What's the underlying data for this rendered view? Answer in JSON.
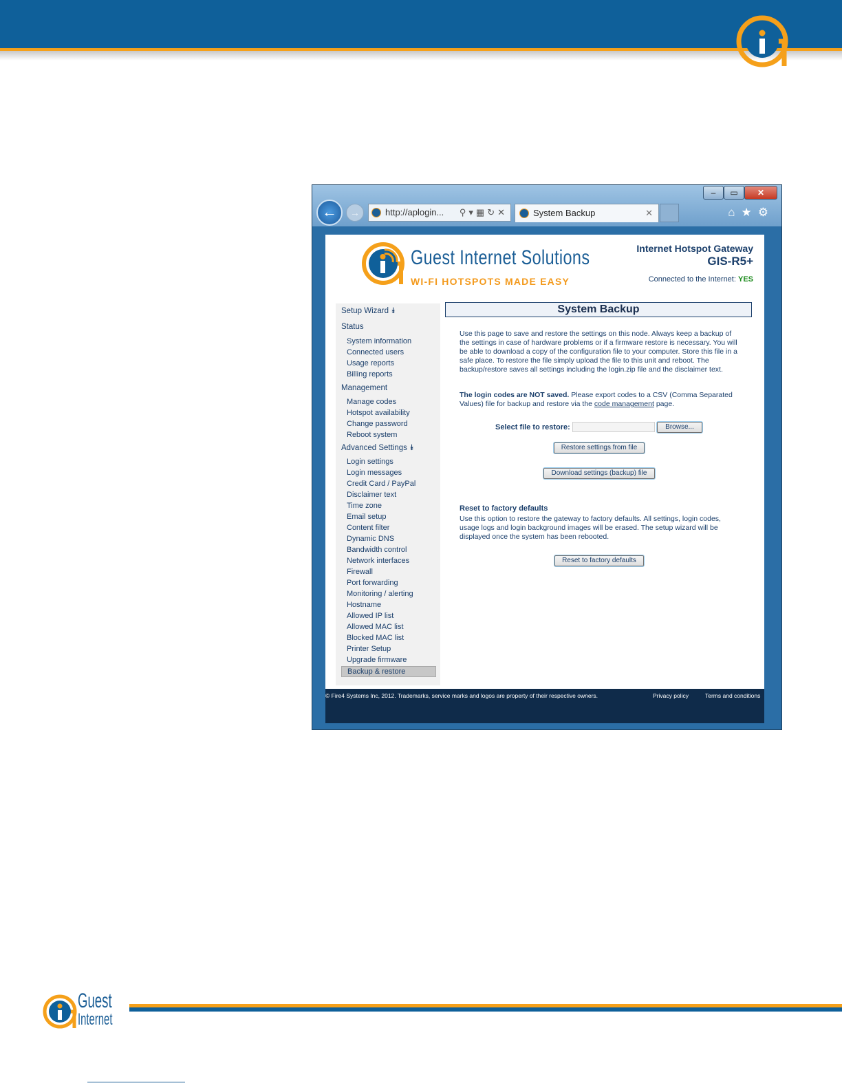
{
  "browser": {
    "address": "http://aplogin...",
    "tab_title": "System Backup",
    "caption_buttons": {
      "minimize": "–",
      "maximize": "▭",
      "close": "✕"
    },
    "toolbar_icons": [
      "home-icon",
      "star-icon",
      "gear-icon"
    ]
  },
  "header": {
    "brand_name": "Guest Internet Solutions",
    "brand_tagline": "WI-FI HOTSPOTS MADE EASY",
    "product_line": "Internet Hotspot Gateway",
    "product_model": "GIS-R5+",
    "connection_label": "Connected to the Internet:",
    "connection_status": "YES"
  },
  "sidebar": {
    "setup_wizard": "Setup Wizard ⯯",
    "status_heading": "Status",
    "status_items": [
      "System information",
      "Connected users",
      "Usage reports",
      "Billing reports"
    ],
    "management_heading": "Management",
    "management_items": [
      "Manage codes",
      "Hotspot availability",
      "Change password",
      "Reboot system"
    ],
    "advanced_heading": "Advanced Settings ⯯",
    "advanced_items": [
      "Login settings",
      "Login messages",
      "Credit Card / PayPal",
      "Disclaimer text",
      "Time zone",
      "Email setup",
      "Content filter",
      "Dynamic DNS",
      "Bandwidth control",
      "Network interfaces",
      "Firewall",
      "Port forwarding",
      "Monitoring / alerting",
      "Hostname",
      "Allowed IP list",
      "Allowed MAC list",
      "Blocked MAC list",
      "Printer Setup",
      "Upgrade firmware"
    ],
    "selected_item": "Backup & restore"
  },
  "main": {
    "title": "System Backup",
    "intro": "Use this page to save and restore the settings on this node. Always keep a backup of the settings in case of hardware problems or if a firmware restore is necessary. You will be able to download a copy of the configuration file to your computer. Store this file in a safe place. To restore the file simply upload the file to this unit and reboot. The backup/restore saves all settings including the login.zip file and the disclaimer text.",
    "codes_note_bold": "The login codes are NOT saved.",
    "codes_note_1": " Please export codes to a CSV (Comma Separated Values) file for backup and restore via the ",
    "codes_note_link": "code management",
    "codes_note_2": " page.",
    "select_file_label": "Select file to restore:",
    "browse_button": "Browse...",
    "restore_button": "Restore settings from file",
    "download_button": "Download settings (backup) file",
    "reset_heading": "Reset to factory defaults",
    "reset_text": "Use this option to restore the gateway to factory defaults. All settings, login codes, usage logs and login background images will be erased. The setup wizard will be displayed once the system has been rebooted.",
    "reset_button": "Reset to factory defaults"
  },
  "footer": {
    "copyright": "© Fire4 Systems Inc, 2012. Trademarks, service marks and logos are property of their respective owners.",
    "privacy": "Privacy policy",
    "terms": "Terms and conditions"
  },
  "document_footer": {
    "logo_word1": "Guest",
    "logo_word2": "Internet"
  },
  "colors": {
    "brand_blue": "#0f609a",
    "brand_orange": "#f5a01a",
    "nav_text": "#1b3f6b"
  }
}
